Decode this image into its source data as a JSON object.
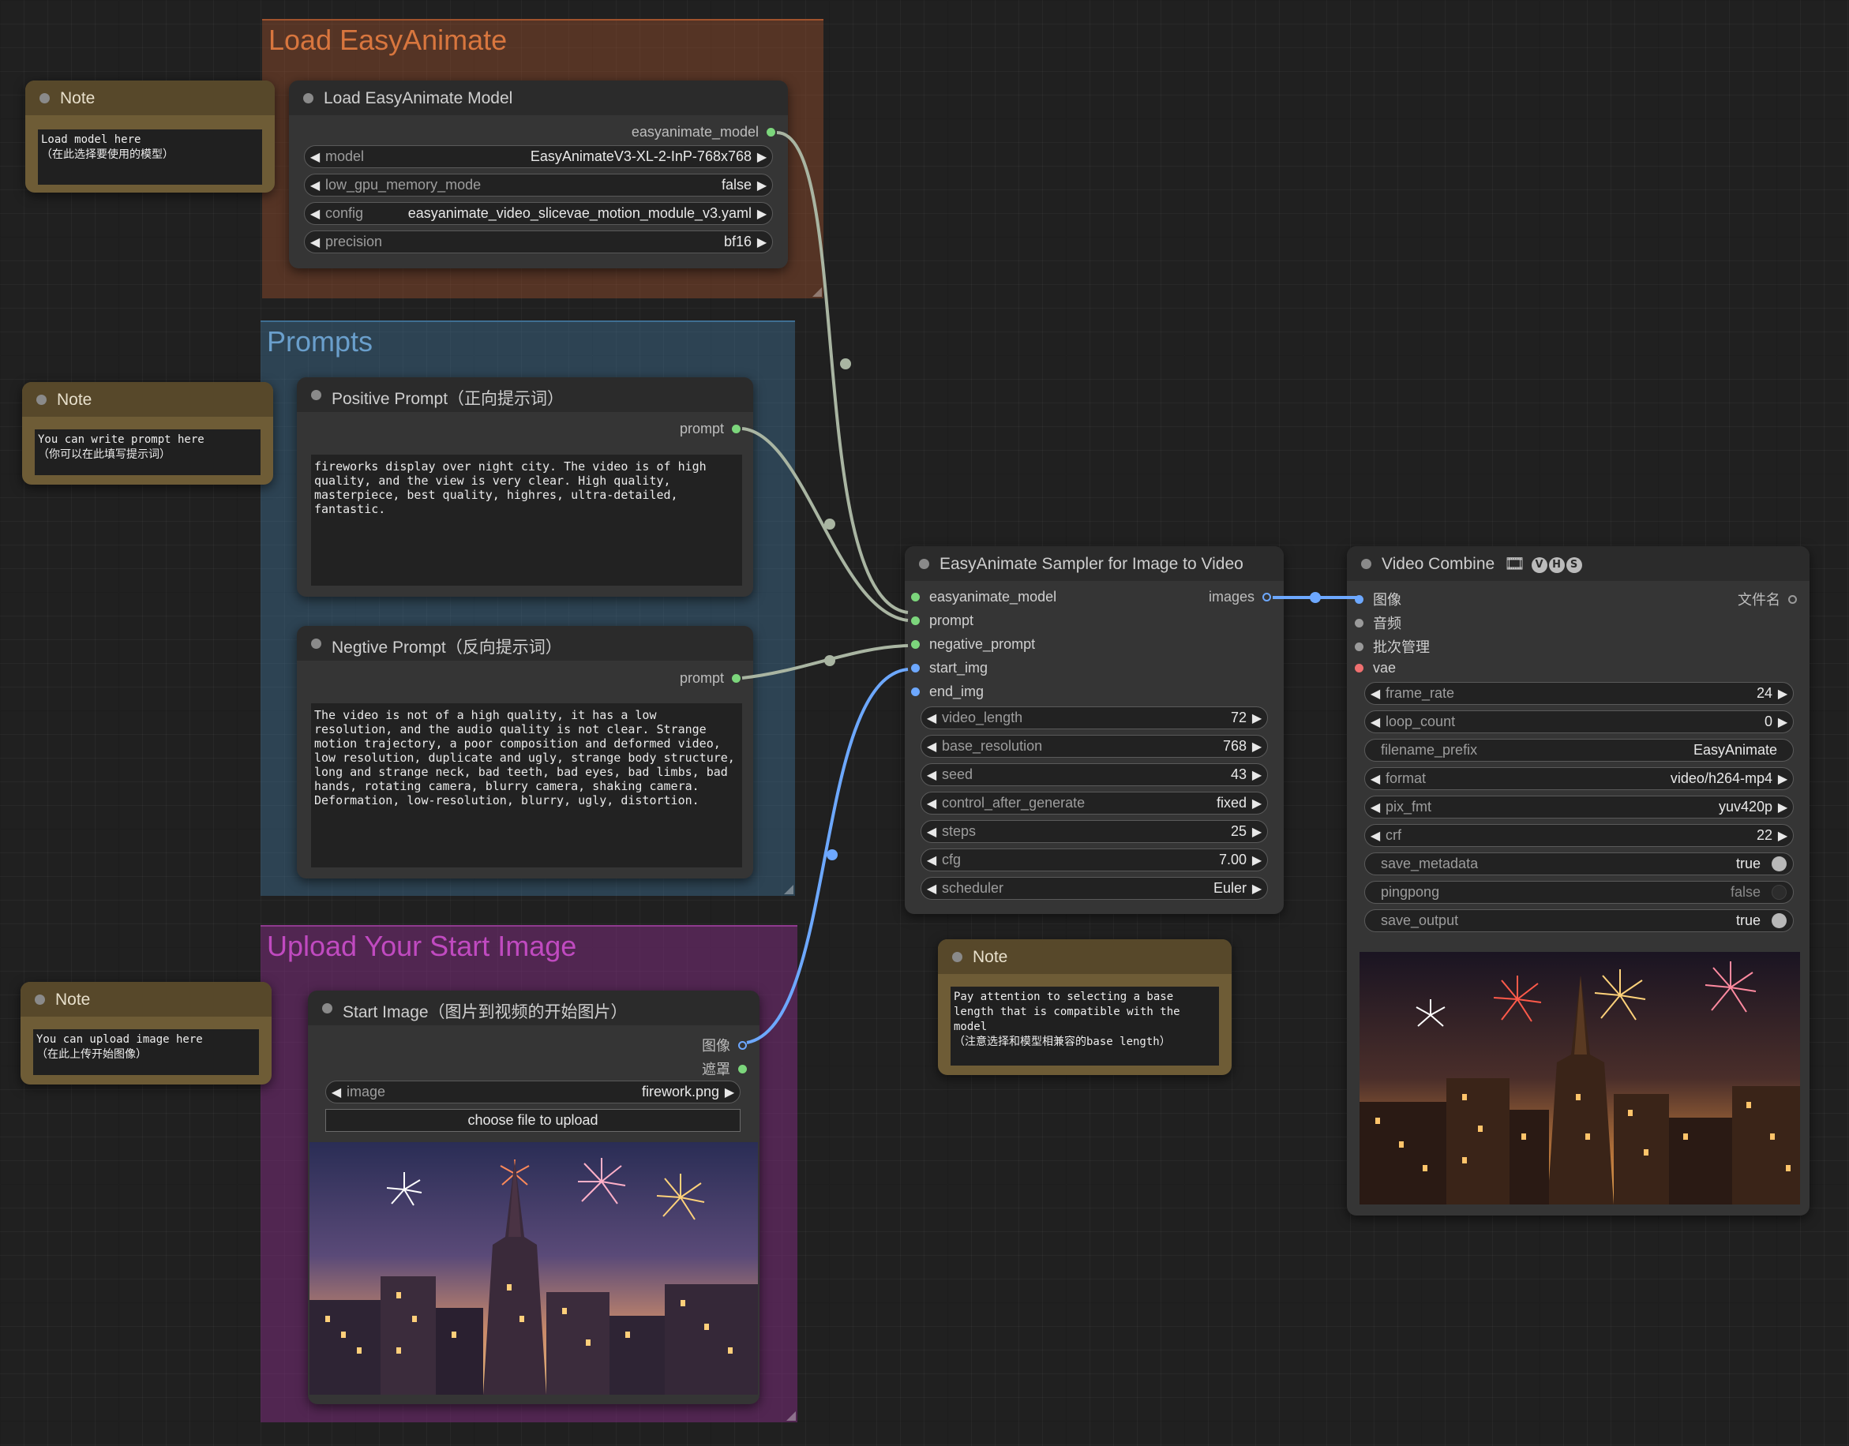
{
  "groups": {
    "load": {
      "title": "Load EasyAnimate",
      "color": "#a0522d",
      "title_color": "#d8763e"
    },
    "prompts": {
      "title": "Prompts",
      "color": "#3f6e92",
      "title_color": "#6a9fcc"
    },
    "upload": {
      "title": "Upload Your Start Image",
      "color": "#7a2b7a",
      "title_color": "#c04ac0"
    }
  },
  "notes": {
    "note1": {
      "title": "Note",
      "text": "Load model here\n（在此选择要使用的模型）"
    },
    "note2": {
      "title": "Note",
      "text": "You can write prompt here\n（你可以在此填写提示词）"
    },
    "note3": {
      "title": "Note",
      "text": "You can upload image here\n（在此上传开始图像）"
    },
    "note4": {
      "title": "Note",
      "text": "Pay attention to selecting a base length that is compatible with the model\n（注意选择和模型相兼容的base length）"
    }
  },
  "load_model": {
    "title": "Load EasyAnimate Model",
    "output": "easyanimate_model",
    "widgets": [
      {
        "label": "model",
        "value": "EasyAnimateV3-XL-2-InP-768x768"
      },
      {
        "label": "low_gpu_memory_mode",
        "value": "false"
      },
      {
        "label": "config",
        "value": "easyanimate_video_slicevae_motion_module_v3.yaml"
      },
      {
        "label": "precision",
        "value": "bf16"
      }
    ]
  },
  "positive": {
    "title": "Positive Prompt（正向提示词）",
    "output": "prompt",
    "text": "fireworks display over night city. The video is of high quality, and the view is very clear. High quality, masterpiece, best quality, highres, ultra-detailed, fantastic."
  },
  "negative": {
    "title": "Negtive Prompt（反向提示词）",
    "output": "prompt",
    "text": "The video is not of a high quality, it has a low resolution, and the audio quality is not clear. Strange motion trajectory, a poor composition and deformed video, low resolution, duplicate and ugly, strange body structure, long and strange neck, bad teeth, bad eyes, bad limbs, bad hands, rotating camera, blurry camera, shaking camera. Deformation, low-resolution, blurry, ugly, distortion."
  },
  "start_image": {
    "title": "Start Image（图片到视频的开始图片）",
    "outputs": [
      "图像",
      "遮罩"
    ],
    "widget": {
      "label": "image",
      "value": "firework.png"
    },
    "upload_button": "choose file to upload"
  },
  "sampler": {
    "title": "EasyAnimate Sampler for Image to Video",
    "inputs": [
      "easyanimate_model",
      "prompt",
      "negative_prompt",
      "start_img",
      "end_img"
    ],
    "output": "images",
    "widgets": [
      {
        "label": "video_length",
        "value": "72"
      },
      {
        "label": "base_resolution",
        "value": "768"
      },
      {
        "label": "seed",
        "value": "43"
      },
      {
        "label": "control_after_generate",
        "value": "fixed"
      },
      {
        "label": "steps",
        "value": "25"
      },
      {
        "label": "cfg",
        "value": "7.00"
      },
      {
        "label": "scheduler",
        "value": "Euler"
      }
    ]
  },
  "video_combine": {
    "title": "Video Combine",
    "badges": [
      "V",
      "H",
      "S"
    ],
    "inputs": [
      "图像",
      "音频",
      "批次管理",
      "vae"
    ],
    "output": "文件名",
    "widgets": [
      {
        "label": "frame_rate",
        "value": "24"
      },
      {
        "label": "loop_count",
        "value": "0"
      },
      {
        "label": "filename_prefix",
        "value": "EasyAnimate"
      },
      {
        "label": "format",
        "value": "video/h264-mp4"
      },
      {
        "label": "pix_fmt",
        "value": "yuv420p"
      },
      {
        "label": "crf",
        "value": "22"
      }
    ],
    "toggles": [
      {
        "label": "save_metadata",
        "value": "true"
      },
      {
        "label": "pingpong",
        "value": "false"
      },
      {
        "label": "save_output",
        "value": "true"
      }
    ]
  },
  "colors": {
    "model_link": "#a9b5a2",
    "prompt_link": "#a9b5a2",
    "image_link": "#6da8ff"
  }
}
